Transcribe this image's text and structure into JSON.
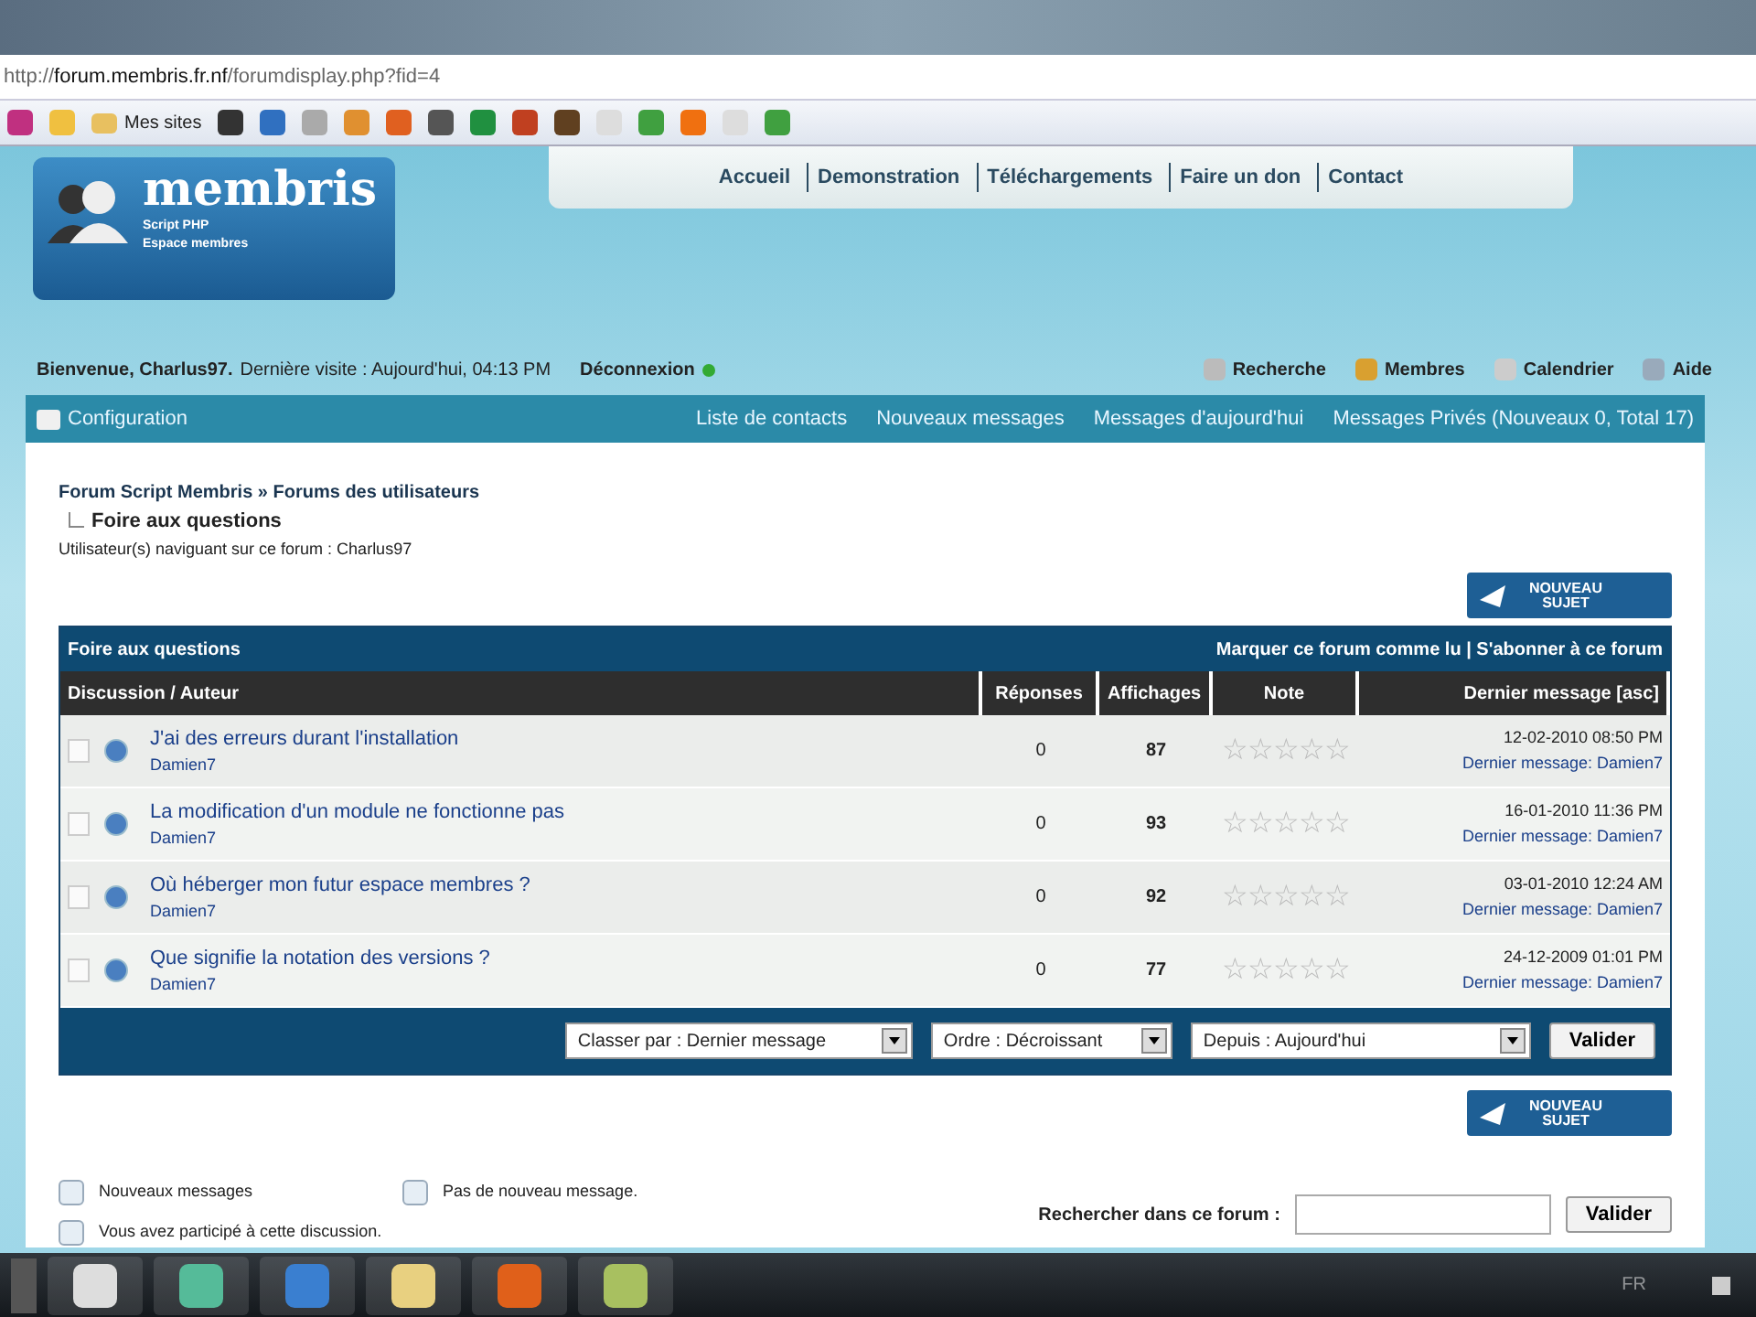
{
  "browser": {
    "address": "http://**forum.membris.fr.nf**/forumdisplay.php?fid=4",
    "bookmark_folder": "Mes sites"
  },
  "logo": {
    "title": "membris",
    "subtitle_1": "Script PHP",
    "subtitle_2": "Espace membres"
  },
  "top_nav": [
    "Accueil",
    "Demonstration",
    "Téléchargements",
    "Faire un don",
    "Contact"
  ],
  "welcome": {
    "user": "Bienvenue, Charlus97.",
    "last_visit": "Dernière visite : Aujourd'hui, 04:13 PM",
    "logout": "Déconnexion"
  },
  "user_links": [
    "Recherche",
    "Membres",
    "Calendrier",
    "Aide"
  ],
  "nav_bar": {
    "config": "Configuration",
    "links": [
      "Liste de contacts",
      "Nouveaux messages",
      "Messages d'aujourd'hui",
      "Messages Privés (Nouveaux 0, Total 17)"
    ]
  },
  "breadcrumb": {
    "path": "Forum Script Membris » Forums des utilisateurs",
    "current": "Foire aux questions",
    "viewers": "Utilisateur(s) naviguant sur ce forum : Charlus97"
  },
  "new_topic_buttons": [
    {
      "label": "NOUVEAU SUJET"
    },
    {
      "label": "NOUVEAU SUJET"
    }
  ],
  "forum_table": {
    "title": "Foire aux questions",
    "actions": "Marquer ce forum comme lu | S'abonner à ce forum",
    "columns": [
      "Discussion / Auteur",
      "Réponses",
      "Affichages",
      "Note",
      "Dernier message [asc]"
    ],
    "rows": [
      {
        "title": "J'ai des erreurs durant l'installation",
        "author": "Damien7",
        "replies": "0",
        "views": "87",
        "stars": 0,
        "date": "12-02-2010 08:50 PM",
        "last": "Dernier message: Damien7"
      },
      {
        "title": "La modification d'un module ne fonctionne pas",
        "author": "Damien7",
        "replies": "0",
        "views": "93",
        "stars": 0,
        "date": "16-01-2010 11:36 PM",
        "last": "Dernier message: Damien7"
      },
      {
        "title": "Où héberger mon futur espace membres ?",
        "author": "Damien7",
        "replies": "0",
        "views": "92",
        "stars": 0,
        "date": "03-01-2010 12:24 AM",
        "last": "Dernier message: Damien7"
      },
      {
        "title": "Que signifie la notation des versions ?",
        "author": "Damien7",
        "replies": "0",
        "views": "77",
        "stars": 0,
        "date": "24-12-2009 01:01 PM",
        "last": "Dernier message: Damien7"
      }
    ],
    "sort": {
      "sort_by": "Classer par : Dernier message",
      "order": "Ordre : Décroissant",
      "since": "Depuis : Aujourd'hui",
      "submit": "Valider"
    }
  },
  "legend": [
    "Nouveaux messages",
    "Pas de nouveau message.",
    "Vous avez participé à cette discussion."
  ],
  "forum_search": {
    "label": "Rechercher dans ce forum :",
    "submit": "Valider"
  },
  "taskbar": {
    "language": "FR"
  }
}
